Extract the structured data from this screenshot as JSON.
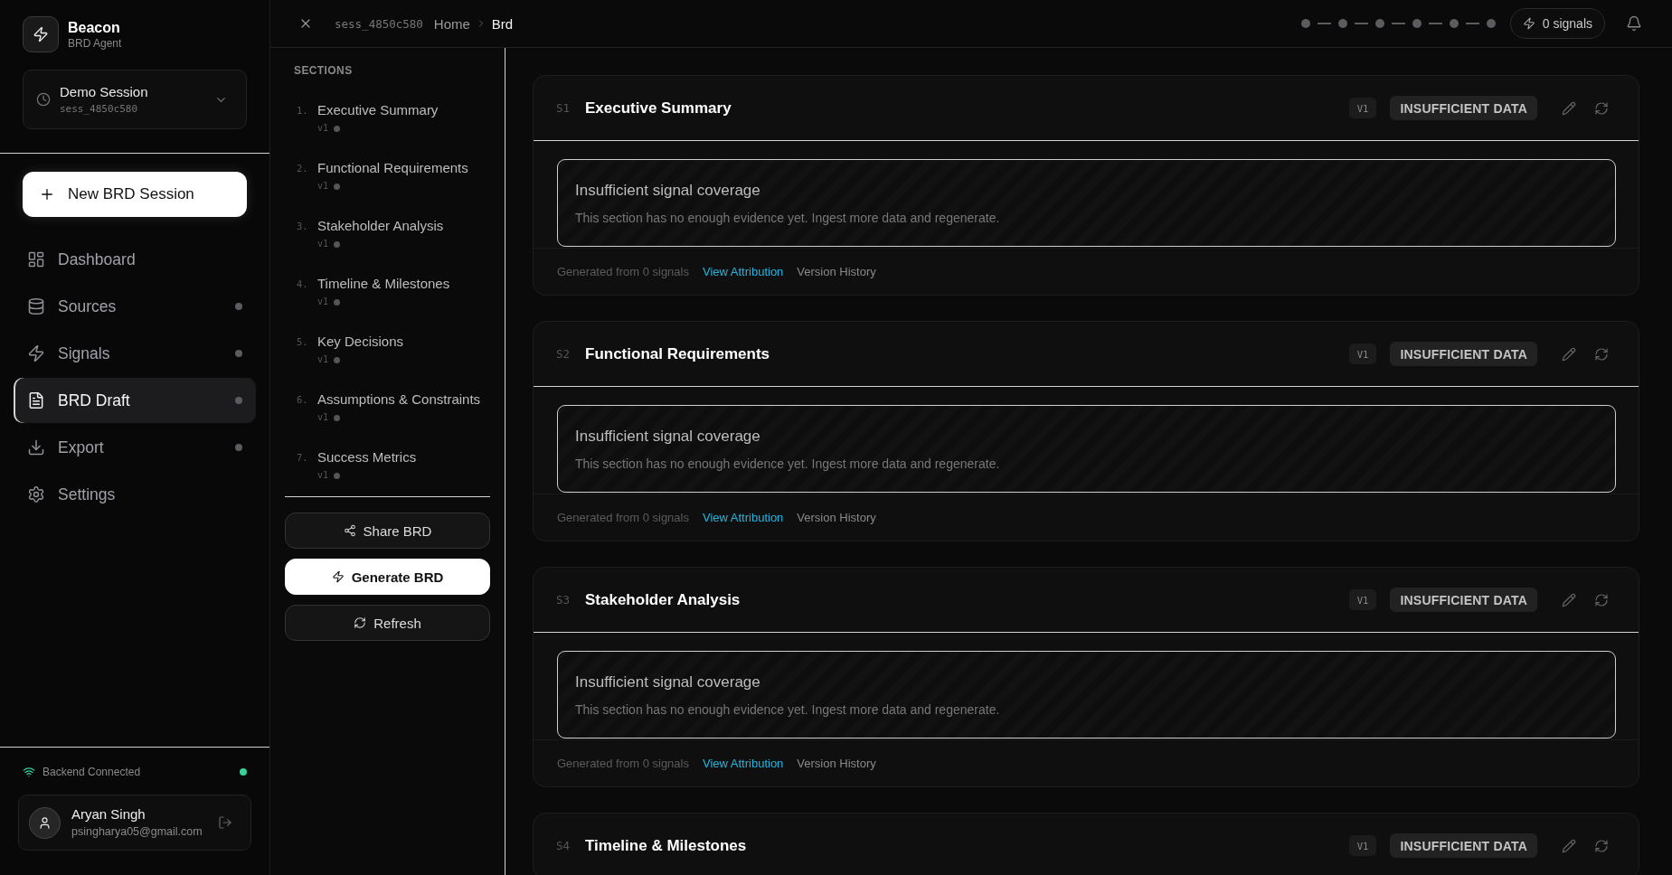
{
  "sidebar": {
    "brand": {
      "name": "Beacon",
      "subtitle": "BRD Agent"
    },
    "session": {
      "title": "Demo Session",
      "session_id": "sess_4850c580"
    },
    "new_session_button": "New BRD Session",
    "nav": [
      {
        "label": "Dashboard",
        "selected": false,
        "dot": false
      },
      {
        "label": "Sources",
        "selected": false,
        "dot": true
      },
      {
        "label": "Signals",
        "selected": false,
        "dot": true
      },
      {
        "label": "BRD Draft",
        "selected": true,
        "dot": true
      },
      {
        "label": "Export",
        "selected": false,
        "dot": true
      },
      {
        "label": "Settings",
        "selected": false,
        "dot": false
      }
    ],
    "connection": {
      "label": "Backend Connected",
      "connected": true
    },
    "user": {
      "name": "Aryan Singh",
      "email": "psingharya05@gmail.com"
    }
  },
  "top_bar": {
    "session_id": "sess_4850c580",
    "breadcrumbs": [
      {
        "label": "Home",
        "current": false
      },
      {
        "label": "Brd",
        "current": true
      }
    ],
    "steps": [
      {
        "completed": false
      },
      {
        "completed": false
      },
      {
        "completed": false
      },
      {
        "completed": false
      },
      {
        "completed": false
      },
      {
        "completed": false
      }
    ],
    "signals": "0 signals"
  },
  "sections_panel": {
    "heading": "SECTIONS",
    "items": [
      {
        "number": "1.",
        "title": "Executive Summary",
        "version": "v1",
        "selected": false
      },
      {
        "number": "2.",
        "title": "Functional Requirements",
        "version": "v1",
        "selected": false
      },
      {
        "number": "3.",
        "title": "Stakeholder Analysis",
        "version": "v1",
        "selected": false
      },
      {
        "number": "4.",
        "title": "Timeline & Milestones",
        "version": "v1",
        "selected": false
      },
      {
        "number": "5.",
        "title": "Key Decisions",
        "version": "v1",
        "selected": false
      },
      {
        "number": "6.",
        "title": "Assumptions & Constraints",
        "version": "v1",
        "selected": false
      },
      {
        "number": "7.",
        "title": "Success Metrics",
        "version": "v1",
        "selected": false
      }
    ],
    "actions": [
      {
        "label": "Share BRD",
        "kind": "secondary"
      },
      {
        "label": "Generate BRD",
        "kind": "primary"
      },
      {
        "label": "Refresh",
        "kind": "secondary"
      }
    ]
  },
  "sections": [
    {
      "code": "S1",
      "title": "Executive Summary",
      "version": "V1",
      "status": "INSUFFICIENT DATA",
      "notice": {
        "title": "Insufficient signal coverage",
        "text": "This section has no enough evidence yet. Ingest more data and regenerate."
      },
      "footer": {
        "source": "Generated from 0 signals",
        "links": [
          {
            "label": "View Attribution",
            "kind": "accent"
          },
          {
            "label": "Version History",
            "kind": "muted"
          }
        ]
      }
    },
    {
      "code": "S2",
      "title": "Functional Requirements",
      "version": "V1",
      "status": "INSUFFICIENT DATA",
      "notice": {
        "title": "Insufficient signal coverage",
        "text": "This section has no enough evidence yet. Ingest more data and regenerate."
      },
      "footer": {
        "source": "Generated from 0 signals",
        "links": [
          {
            "label": "View Attribution",
            "kind": "accent"
          },
          {
            "label": "Version History",
            "kind": "muted"
          }
        ]
      }
    },
    {
      "code": "S3",
      "title": "Stakeholder Analysis",
      "version": "V1",
      "status": "INSUFFICIENT DATA",
      "notice": {
        "title": "Insufficient signal coverage",
        "text": "This section has no enough evidence yet. Ingest more data and regenerate."
      },
      "footer": {
        "source": "Generated from 0 signals",
        "links": [
          {
            "label": "View Attribution",
            "kind": "accent"
          },
          {
            "label": "Version History",
            "kind": "muted"
          }
        ]
      }
    },
    {
      "code": "S4",
      "title": "Timeline & Milestones",
      "version": "V1",
      "status": "INSUFFICIENT DATA"
    }
  ]
}
